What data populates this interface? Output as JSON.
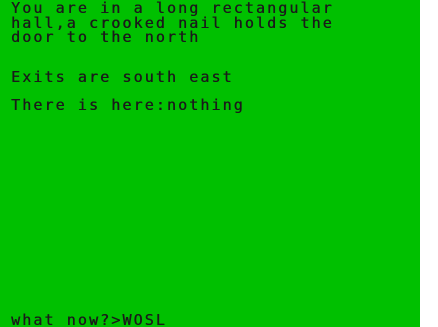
{
  "screen": {
    "background": "#00c000",
    "text_color": "#1a1a1a"
  },
  "description": [
    "You are in a long rectangular",
    "hall,a crooked nail holds the",
    "door to the north"
  ],
  "exits": "Exits are south east",
  "contents": "There is here:nothing",
  "prompt": {
    "label": "what now?>",
    "input": "WOSL"
  }
}
